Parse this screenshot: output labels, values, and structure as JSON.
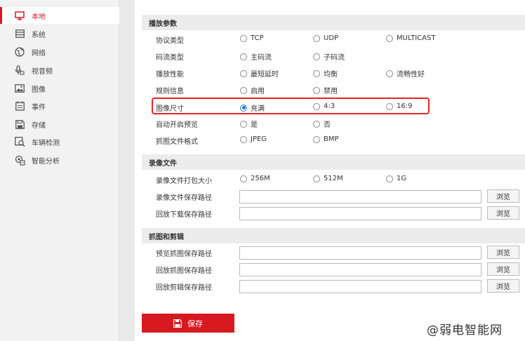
{
  "sidebar": {
    "items": [
      {
        "label": "本地",
        "icon": "monitor-icon"
      },
      {
        "label": "系统",
        "icon": "system-icon"
      },
      {
        "label": "网络",
        "icon": "globe-icon"
      },
      {
        "label": "视音频",
        "icon": "audio-video-icon"
      },
      {
        "label": "图像",
        "icon": "image-icon"
      },
      {
        "label": "事件",
        "icon": "calendar-icon"
      },
      {
        "label": "存储",
        "icon": "storage-icon"
      },
      {
        "label": "车辆检测",
        "icon": "vehicle-search-icon"
      },
      {
        "label": "智能分析",
        "icon": "smart-analysis-icon"
      }
    ]
  },
  "play_params": {
    "title": "播放参数",
    "rows": [
      {
        "label": "协议类型",
        "options": [
          "TCP",
          "UDP",
          "MULTICAST"
        ],
        "selected": null
      },
      {
        "label": "码流类型",
        "options": [
          "主码流",
          "子码流"
        ],
        "selected": null
      },
      {
        "label": "播放性能",
        "options": [
          "最短延时",
          "均衡",
          "流畅性好"
        ],
        "selected": null
      },
      {
        "label": "规则信息",
        "options": [
          "启用",
          "禁用"
        ],
        "selected": null
      },
      {
        "label": "图像尺寸",
        "options": [
          "充满",
          "4:3",
          "16:9"
        ],
        "selected": 0
      },
      {
        "label": "自动开启预览",
        "options": [
          "是",
          "否"
        ],
        "selected": null
      },
      {
        "label": "抓图文件格式",
        "options": [
          "JPEG",
          "BMP"
        ],
        "selected": null
      }
    ]
  },
  "record_files": {
    "title": "录像文件",
    "size_row": {
      "label": "录像文件打包大小",
      "options": [
        "256M",
        "512M",
        "1G"
      ],
      "selected": null
    },
    "paths": [
      {
        "label": "录像文件保存路径",
        "value": "",
        "button": "浏览"
      },
      {
        "label": "回放下载保存路径",
        "value": "",
        "button": "浏览"
      }
    ]
  },
  "capture_clip": {
    "title": "抓图和剪辑",
    "paths": [
      {
        "label": "预览抓图保存路径",
        "value": "",
        "button": "浏览"
      },
      {
        "label": "回放抓图保存路径",
        "value": "",
        "button": "浏览"
      },
      {
        "label": "回放剪辑保存路径",
        "value": "",
        "button": "浏览"
      }
    ]
  },
  "save_button": {
    "label": "保存",
    "icon": "save-icon",
    "color": "#d71920"
  },
  "watermark": "@弱电智能网",
  "colors": {
    "accent": "#d71920",
    "radio_checked": "#1e74d6",
    "highlight": "#e02525"
  }
}
